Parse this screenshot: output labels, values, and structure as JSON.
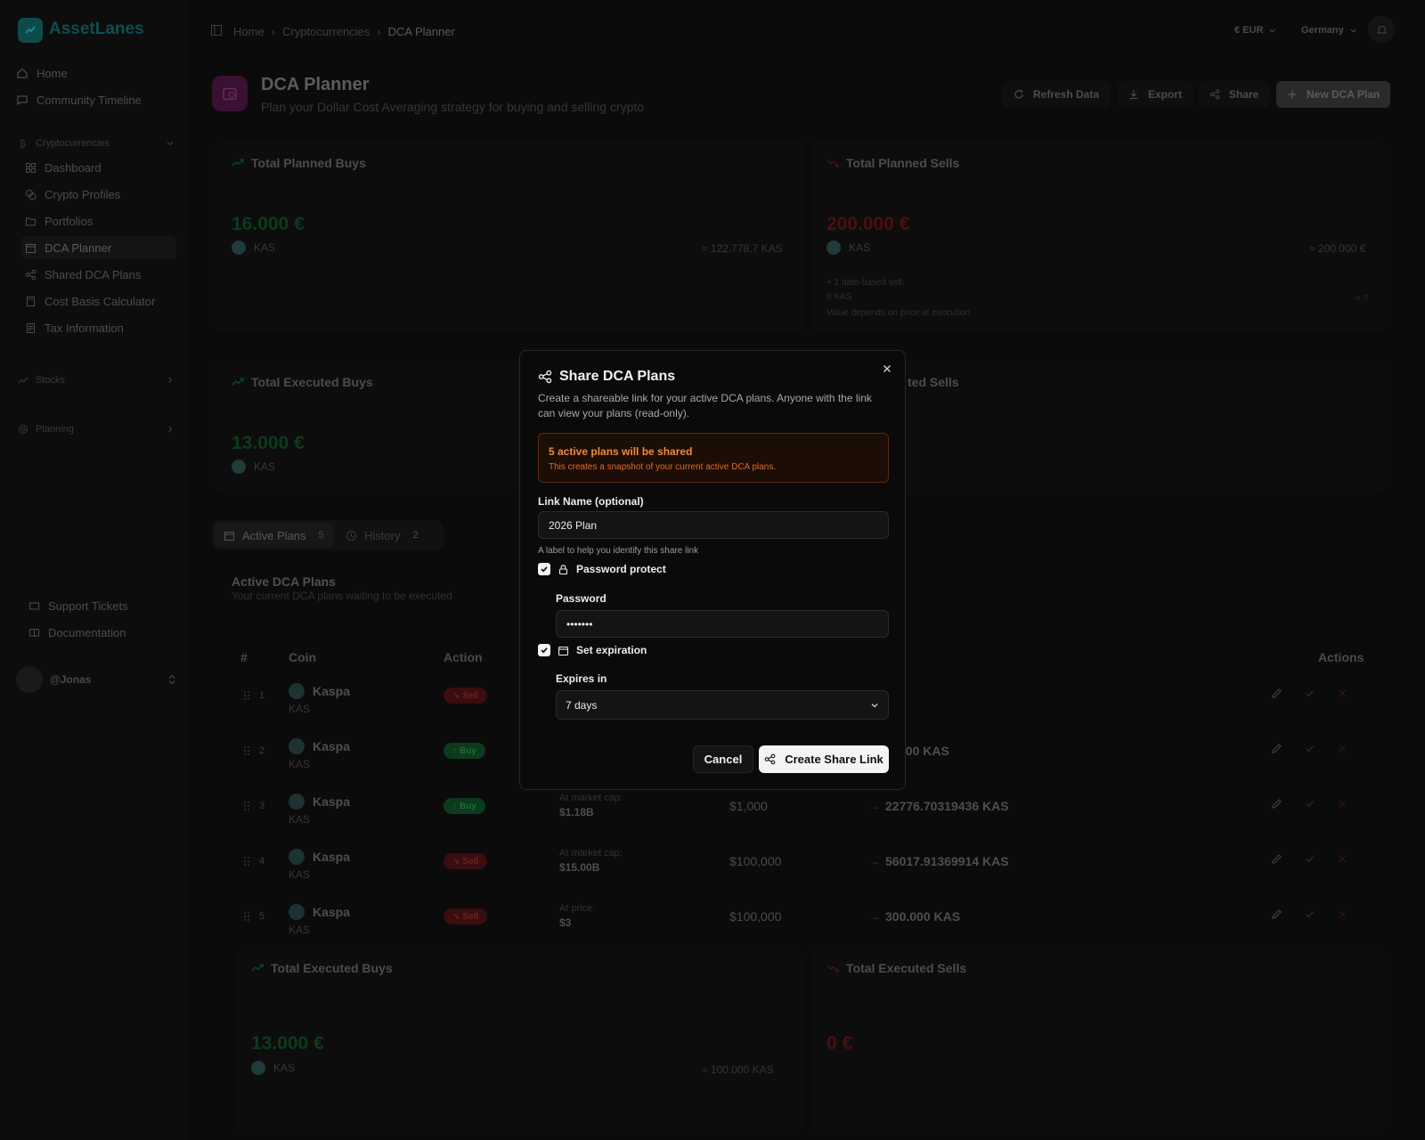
{
  "app": {
    "name": "AssetLanes"
  },
  "sidebar": {
    "top_items": [
      {
        "label": "Home",
        "icon": "home-icon"
      },
      {
        "label": "Community Timeline",
        "icon": "message-icon"
      }
    ],
    "crypto_section": "Cryptocurrencies",
    "crypto_items": [
      {
        "label": "Dashboard",
        "icon": "grid-icon"
      },
      {
        "label": "Crypto Profiles",
        "icon": "coins-icon"
      },
      {
        "label": "Portfolios",
        "icon": "folder-icon"
      },
      {
        "label": "DCA Planner",
        "icon": "calendar-icon"
      },
      {
        "label": "Shared DCA Plans",
        "icon": "share-icon"
      },
      {
        "label": "Cost Basis Calculator",
        "icon": "calculator-icon"
      },
      {
        "label": "Tax Information",
        "icon": "document-icon"
      }
    ],
    "stocks_section": "Stocks",
    "planning_section": "Planning",
    "bottom_items": [
      {
        "label": "Support Tickets",
        "icon": "ticket-icon"
      },
      {
        "label": "Documentation",
        "icon": "book-icon"
      }
    ],
    "user": "@Jonas"
  },
  "breadcrumb": {
    "items": [
      "Home",
      "Cryptocurrencies"
    ],
    "current": "DCA Planner"
  },
  "topbar": {
    "currency": "€ EUR",
    "country": "Germany"
  },
  "page": {
    "title": "DCA Planner",
    "subtitle": "Plan your Dollar Cost Averaging strategy for buying and selling crypto",
    "buttons": {
      "refresh": "Refresh Data",
      "export": "Export",
      "share": "Share",
      "new_plan": "New DCA Plan"
    }
  },
  "cards": {
    "planned_buys": {
      "title": "Total Planned Buys",
      "value": "16.000 €",
      "coin": "KAS",
      "approx": "≈ 122.778,7 KAS"
    },
    "planned_sells": {
      "title": "Total Planned Sells",
      "value": "200.000 €",
      "coin": "KAS",
      "approx": "≈ 200.000 €",
      "note1": "+ 1 date-based sell:",
      "note2": "0 KAS",
      "note3": "Value depends on price at execution",
      "note_right": "≈ ?"
    },
    "executed_buys": {
      "title": "Total Executed Buys",
      "value": "13.000 €",
      "coin": "KAS"
    },
    "executed_sells_partial": {
      "title": "ted Sells"
    },
    "executed_buys_2": {
      "title": "Total Executed Buys",
      "value": "13.000 €",
      "coin": "KAS",
      "approx": "≈ 100.000 KAS"
    },
    "executed_sells_2": {
      "title": "Total Executed Sells",
      "value": "0 €"
    }
  },
  "tabs": [
    {
      "label": "Active Plans",
      "count": "5"
    },
    {
      "label": "History",
      "count": "2"
    }
  ],
  "table": {
    "title": "Active DCA Plans",
    "subtitle": "Your current DCA plans waiting to be executed",
    "headers": {
      "num": "#",
      "coin": "Coin",
      "action": "Action",
      "actions": "Actions"
    },
    "rows": [
      {
        "n": "1",
        "coin": "Kaspa",
        "sym": "KAS",
        "action": "Sell",
        "type": "sell",
        "cond_label": "",
        "cond_value": "",
        "amount": "",
        "result": ""
      },
      {
        "n": "2",
        "coin": "Kaspa",
        "sym": "KAS",
        "action": "Buy",
        "type": "buy",
        "cond_label": "",
        "cond_value": "",
        "amount": "",
        "result": "000 KAS"
      },
      {
        "n": "3",
        "coin": "Kaspa",
        "sym": "KAS",
        "action": "Buy",
        "type": "buy",
        "cond_label": "At market cap:",
        "cond_value": "$1.18B",
        "amount": "$1,000",
        "result": "22776.70319436 KAS"
      },
      {
        "n": "4",
        "coin": "Kaspa",
        "sym": "KAS",
        "action": "Sell",
        "type": "sell",
        "cond_label": "At market cap:",
        "cond_value": "$15.00B",
        "amount": "$100,000",
        "result": "56017.91369914 KAS"
      },
      {
        "n": "5",
        "coin": "Kaspa",
        "sym": "KAS",
        "action": "Sell",
        "type": "sell",
        "cond_label": "At price:",
        "cond_value": "$3",
        "amount": "$100,000",
        "result": "300.000 KAS"
      }
    ]
  },
  "modal": {
    "title": "Share DCA Plans",
    "description": "Create a shareable link for your active DCA plans. Anyone with the link can view your plans (read-only).",
    "warning_title": "5 active plans will be shared",
    "warning_sub": "This creates a snapshot of your current active DCA plans.",
    "link_name_label": "Link Name (optional)",
    "link_name_value": "2026 Plan",
    "link_name_help": "A label to help you identify this share link",
    "password_protect_label": "Password protect",
    "password_protect_checked": true,
    "password_label": "Password",
    "password_value": "•••••••",
    "expiration_label": "Set expiration",
    "expiration_checked": true,
    "expires_label": "Expires in",
    "expires_value": "7 days",
    "cancel": "Cancel",
    "create": "Create Share Link"
  }
}
